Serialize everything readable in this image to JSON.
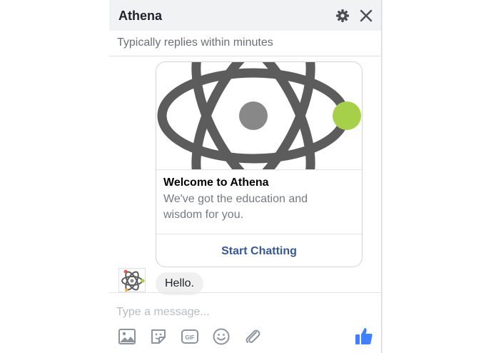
{
  "header": {
    "title": "Athena",
    "subtitle": "Typically replies within minutes",
    "icons": [
      "gear-icon",
      "close-icon"
    ]
  },
  "card": {
    "image_icon": "atom-logo",
    "title": "Welcome to Athena",
    "description": "We've got the education and wisdom for you.",
    "button_label": "Start Chatting"
  },
  "message": {
    "avatar_icon": "atom-avatar-icon",
    "text": "Hello."
  },
  "composer": {
    "placeholder": "Type a message...",
    "tools": [
      "photo-icon",
      "sticker-icon",
      "gif-icon",
      "emoji-icon",
      "attachment-icon"
    ],
    "gif_label": "GIF",
    "send_icon": "thumbs-up-icon"
  },
  "colors": {
    "header_bg": "#f1f2f4",
    "link_blue": "#365899",
    "accent_green": "#a6cf4a",
    "atom_gray": "#5c5c5c",
    "icon_gray": "#8d949e",
    "like_blue": "#4080ff"
  }
}
